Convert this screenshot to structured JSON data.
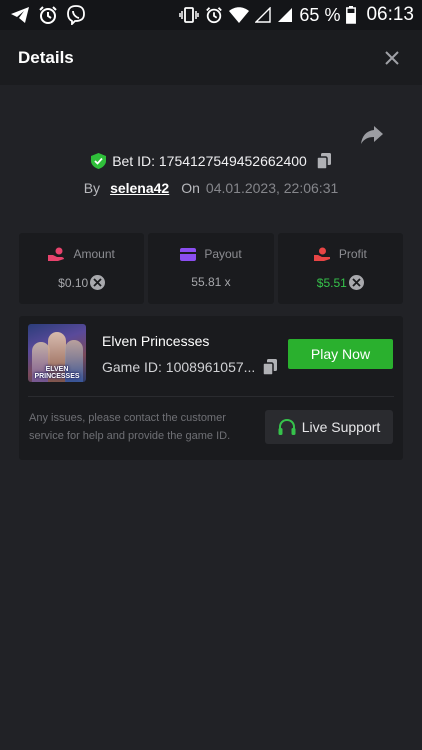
{
  "status_bar": {
    "left_icons": [
      "telegram-icon",
      "alarm-icon",
      "viber-icon"
    ],
    "right_icons": [
      "vibrate-icon",
      "alarm-icon",
      "wifi-icon",
      "signal-empty-icon",
      "signal-icon"
    ],
    "battery": "65 %",
    "time": "06:13"
  },
  "header": {
    "title": "Details"
  },
  "bet": {
    "id_label": "Bet ID: 1754127549452662400",
    "by_label": "By",
    "username": "selena42",
    "on_label": "On",
    "datetime": "04.01.2023, 22:06:31"
  },
  "stats": {
    "amount": {
      "label": "Amount",
      "value": "$0.10"
    },
    "payout": {
      "label": "Payout",
      "value": "55.81 x"
    },
    "profit": {
      "label": "Profit",
      "value": "$5.51"
    }
  },
  "game": {
    "name": "Elven Princesses",
    "id_label": "Game ID: 1008961057...",
    "thumbnail_text": "ELVEN PRINCESSES",
    "play_label": "Play Now"
  },
  "support": {
    "help_text": "Any issues, please contact the customer service for help and provide the game ID.",
    "button_label": "Live Support"
  },
  "colors": {
    "background": "#212226",
    "card": "#1a1b1e",
    "accent_green": "#2ab02e",
    "amount_icon": "#e8436d",
    "payout_icon": "#8b4ef0",
    "profit_icon": "#e84545"
  }
}
